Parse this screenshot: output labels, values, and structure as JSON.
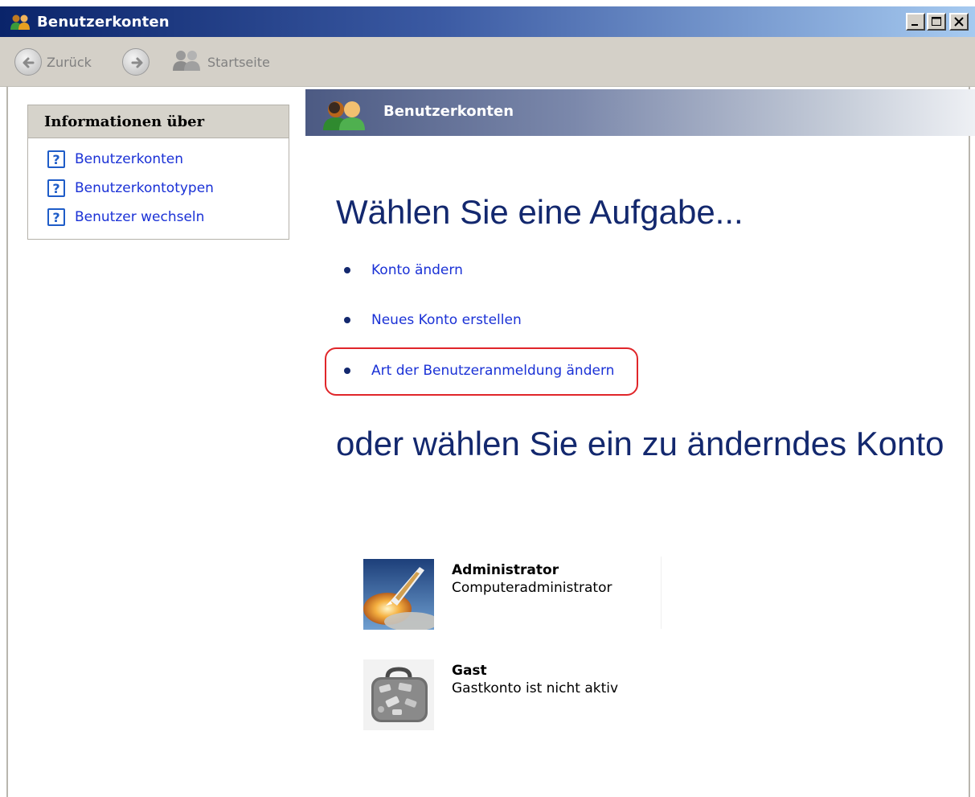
{
  "window": {
    "title": "Benutzerkonten"
  },
  "toolbar": {
    "back_label": "Zurück",
    "home_label": "Startseite"
  },
  "sidebar": {
    "header": "Informationen über",
    "links": [
      {
        "label": "Benutzerkonten",
        "icon": "help-icon"
      },
      {
        "label": "Benutzerkontotypen",
        "icon": "help-icon"
      },
      {
        "label": "Benutzer wechseln",
        "icon": "help-icon"
      }
    ]
  },
  "banner": {
    "title": "Benutzerkonten"
  },
  "main": {
    "task_heading": "Wählen Sie eine Aufgabe...",
    "tasks": [
      {
        "label": "Konto ändern"
      },
      {
        "label": "Neues Konto erstellen"
      },
      {
        "label": "Art der Benutzeranmeldung ändern",
        "highlighted": true
      }
    ],
    "account_heading": "oder wählen Sie ein zu änderndes Konto",
    "accounts": [
      {
        "name": "Administrator",
        "description": "Computeradministrator",
        "picture": "space-shuttle-launch"
      },
      {
        "name": "Gast",
        "description": "Gastkonto ist nicht aktiv",
        "picture": "suitcase"
      }
    ]
  },
  "colors": {
    "heading": "#13286e",
    "link": "#1a31d6",
    "highlight_border": "#e0262a",
    "titlebar_start": "#0a246a"
  }
}
